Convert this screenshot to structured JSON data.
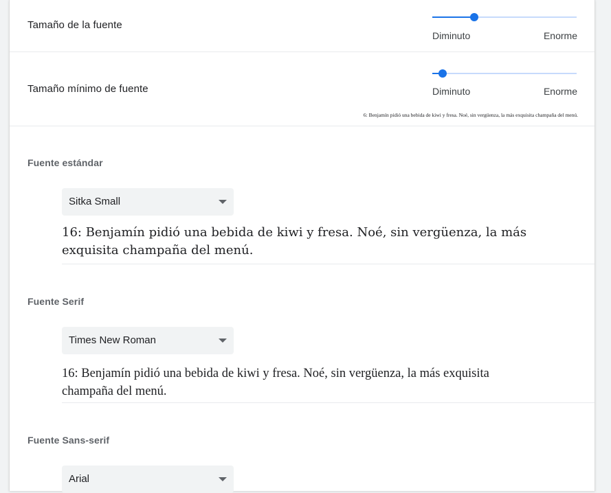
{
  "font_size": {
    "label": "Tamaño de la fuente",
    "min_label": "Diminuto",
    "max_label": "Enorme",
    "value_fraction": 0.29
  },
  "min_font_size": {
    "label": "Tamaño mínimo de fuente",
    "min_label": "Diminuto",
    "max_label": "Enorme",
    "value_fraction": 0.07,
    "sample": "6: Benjamín pidió una bebida de kiwi y fresa. Noé, sin vergüenza, la más exquisita champaña del menú."
  },
  "standard_font": {
    "heading": "Fuente estándar",
    "selected": "Sitka Small",
    "sample": "16: Benjamín pidió una bebida de kiwi y fresa. Noé, sin vergüenza, la más exquisita champaña del menú."
  },
  "serif_font": {
    "heading": "Fuente Serif",
    "selected": "Times New Roman",
    "sample": "16: Benjamín pidió una bebida de kiwi y fresa. Noé, sin vergüenza, la más exquisita champaña del menú."
  },
  "sans_serif_font": {
    "heading": "Fuente Sans-serif",
    "selected": "Arial"
  },
  "colors": {
    "accent": "#1a73e8",
    "track": "#c6dafc",
    "select_bg": "#f1f3f4"
  }
}
